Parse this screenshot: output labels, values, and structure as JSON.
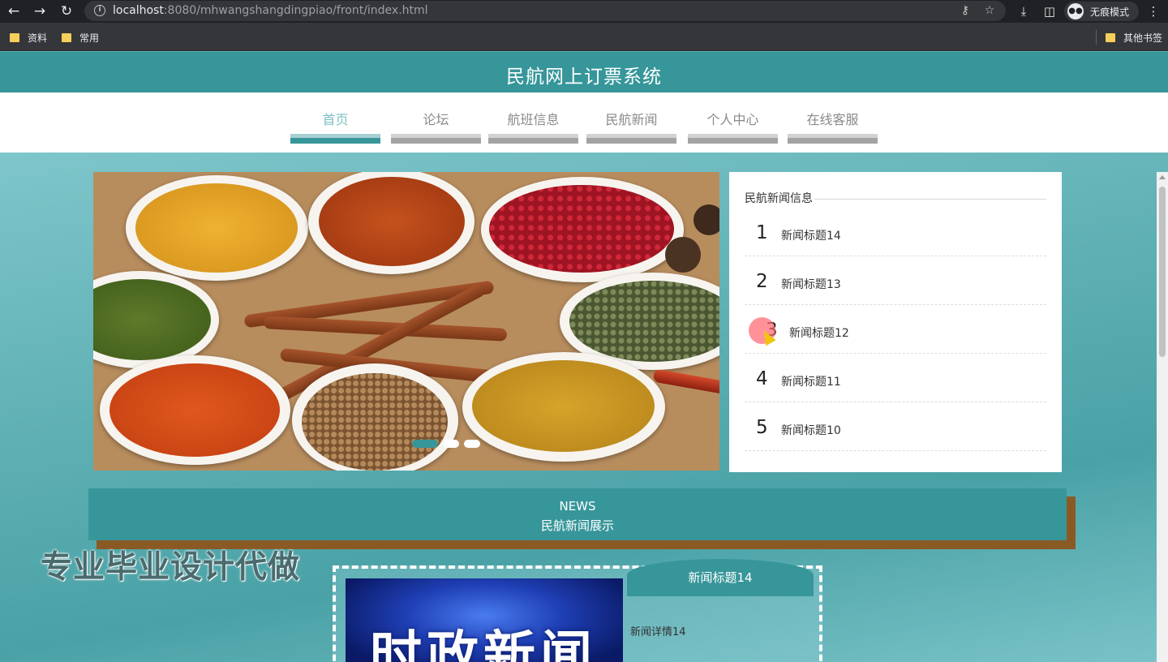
{
  "browser": {
    "url_host": "localhost",
    "url_rest": ":8080/mhwangshangdingpiao/front/index.html",
    "incognito_label": "无痕模式",
    "bookmarks": [
      "资料",
      "常用"
    ],
    "other_bookmarks": "其他书签",
    "icons": [
      "back-arrow-icon",
      "forward-arrow-icon",
      "reload-icon",
      "info-icon",
      "key-icon",
      "star-icon",
      "download-icon",
      "sidepanel-icon",
      "incognito-icon",
      "kebab-menu-icon",
      "folder-icon"
    ]
  },
  "site": {
    "title": "民航网上订票系统",
    "nav": [
      "首页",
      "论坛",
      "航班信息",
      "民航新闻",
      "个人中心",
      "在线客服"
    ],
    "active_nav_index": 0,
    "accent_color": "#37969a"
  },
  "news_panel": {
    "title": "民航新闻信息",
    "items": [
      {
        "num": "1",
        "title": "新闻标题14"
      },
      {
        "num": "2",
        "title": "新闻标题13"
      },
      {
        "num": "3",
        "title": "新闻标题12"
      },
      {
        "num": "4",
        "title": "新闻标题11"
      },
      {
        "num": "5",
        "title": "新闻标题10"
      }
    ]
  },
  "carousel": {
    "slide_count": 3,
    "active_index": 0
  },
  "section": {
    "en": "NEWS",
    "zh": "民航新闻展示"
  },
  "watermark": "专业毕业设计代做",
  "news_card": {
    "title": "新闻标题14",
    "body": "新闻详情14",
    "image_text": "时政新闻"
  }
}
